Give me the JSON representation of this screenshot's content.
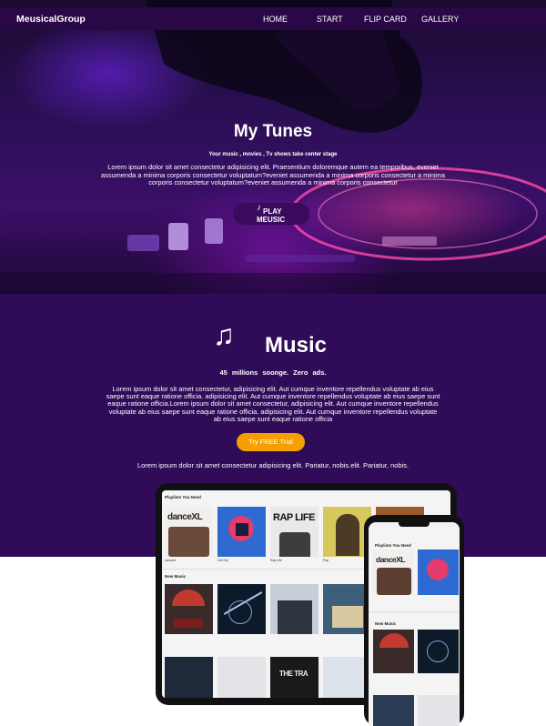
{
  "nav": {
    "brand": "MeusicalGroup",
    "links": [
      "HOME",
      "START",
      "FLIP CARD",
      "GALLERY"
    ]
  },
  "hero": {
    "title": "My Tunes",
    "tagline": "Your music , movies , Tv shows take center stage",
    "description": "Lorem ipsum dolor sit amet consectetur adipisicing elit. Praesentium doloremque autem ea temporibus, eveniet assumenda a minima corporis consectetur voluptatum?eveniet assumenda a minima corporis consectetur a minima corporis consectetur voluptatum?eveniet assumenda a minima corporis consectetur",
    "play_icon": "music-note-icon",
    "play_label_line1": "PLAY",
    "play_label_line2": "MEUSIC"
  },
  "music": {
    "icon": "music-notes-icon",
    "title": "Music",
    "stats": "45 millions soonge. Zero ads.",
    "description": "Lorem ipsum dolor sit amet consectetur, adipisicing elit. Aut cumque inventore repellendus voluptate ab eius saepe sunt eaque ratione officia. adipisicing elit. Aut cumque inventore repellendus voluptate ab eius saepe sunt eaque ratione officia.Lorem ipsum dolor sit amet consectetur, adipisicing elit. Aut cumque inventore repellendus voluptate ab eius saepe sunt eaque ratione officia. adipisicing elit. Aut cumque inventore repellendus voluptate ab eius saepe sunt eaque ratione officia",
    "trial_label": "Try FREE Trial",
    "footnote": "Lorem ipsum dolor sit amet consectetur adipisicing elit. Pariatur, nobis.elit. Pariatur, nobis."
  },
  "devices": {
    "tablet": {
      "section1": "Playlists You Need",
      "section2": "New Music",
      "album_texts": [
        "danceXL",
        "RAP LIFE",
        "THE TRA"
      ]
    },
    "phone": {
      "section1": "Playlists You Need",
      "section2": "New Music",
      "album_text": "danceXL"
    }
  },
  "colors": {
    "nav_bg": "#2a0846",
    "section_bg": "#2f0b58",
    "accent": "#f5a000",
    "button_bg": "#3a0a5c"
  }
}
